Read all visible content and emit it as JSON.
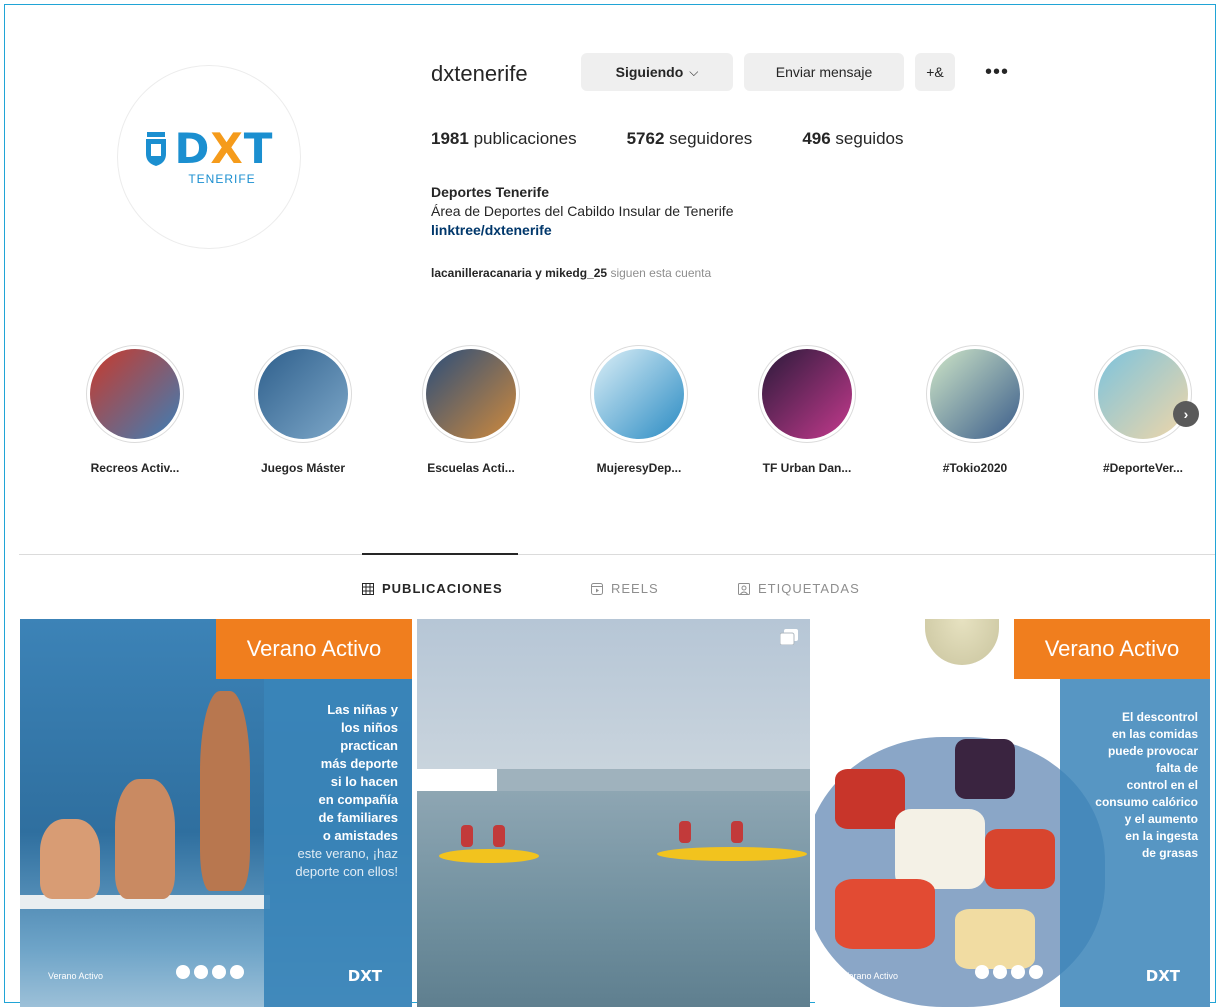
{
  "profile": {
    "username": "dxtenerife",
    "logo_text": "DXT",
    "logo_subtitle": "TENERIFE",
    "actions": {
      "following": "Siguiendo",
      "following_chevron": "⌵",
      "message": "Enviar mensaje",
      "suggest_icon": "+&",
      "more": "•••"
    },
    "stats": [
      {
        "value": "1981",
        "label": "publicaciones"
      },
      {
        "value": "5762",
        "label": "seguidores"
      },
      {
        "value": "496",
        "label": "seguidos"
      }
    ],
    "bio": {
      "name": "Deportes Tenerife",
      "description": "Área de Deportes del Cabildo Insular de Tenerife",
      "link": "linktree/dxtenerife"
    },
    "followed_by": {
      "users": "lacanilleracanaria y mikedg_25",
      "suffix": "siguen esta cuenta"
    }
  },
  "highlights": [
    {
      "label": "Recreos Activ...",
      "colors": [
        "#c9392b",
        "#3c7fb7"
      ]
    },
    {
      "label": "Juegos Máster",
      "colors": [
        "#2e5f8c",
        "#7ea8c9"
      ]
    },
    {
      "label": "Escuelas Acti...",
      "colors": [
        "#2a4d7a",
        "#d08a3c"
      ]
    },
    {
      "label": "MujeresyDep...",
      "colors": [
        "#dbeff7",
        "#2a8bc3"
      ]
    },
    {
      "label": "TF Urban Dan...",
      "colors": [
        "#2a1a3a",
        "#c43a8d"
      ]
    },
    {
      "label": "#Tokio2020",
      "colors": [
        "#cfe6c8",
        "#3a5c8a"
      ]
    },
    {
      "label": "#DeporteVer...",
      "colors": [
        "#7cc3dd",
        "#f0d6a8"
      ]
    }
  ],
  "tabs": [
    {
      "label": "PUBLICACIONES",
      "active": true
    },
    {
      "label": "REELS",
      "active": false
    },
    {
      "label": "ETIQUETADAS",
      "active": false
    }
  ],
  "posts": {
    "p1": {
      "badge": "Verano Activo",
      "text_lines": [
        "Las niñas y",
        "los niños",
        "practican",
        "más deporte",
        "si lo hacen",
        "en compañía",
        "de familiares",
        "o amistades"
      ],
      "text_light": "este verano, ¡haz deporte con ellos!",
      "footer": "Verano Activo",
      "logo": "DXT"
    },
    "p2": {
      "multi_icon": "carousel-icon"
    },
    "p3": {
      "badge": "Verano Activo",
      "text_lines": [
        "El descontrol",
        "en las comidas",
        "puede provocar",
        "falta de",
        "control en el",
        "consumo calórico",
        "y el aumento",
        "en la ingesta",
        "de grasas"
      ],
      "footer": "Verano Activo",
      "logo": "DXT"
    }
  }
}
